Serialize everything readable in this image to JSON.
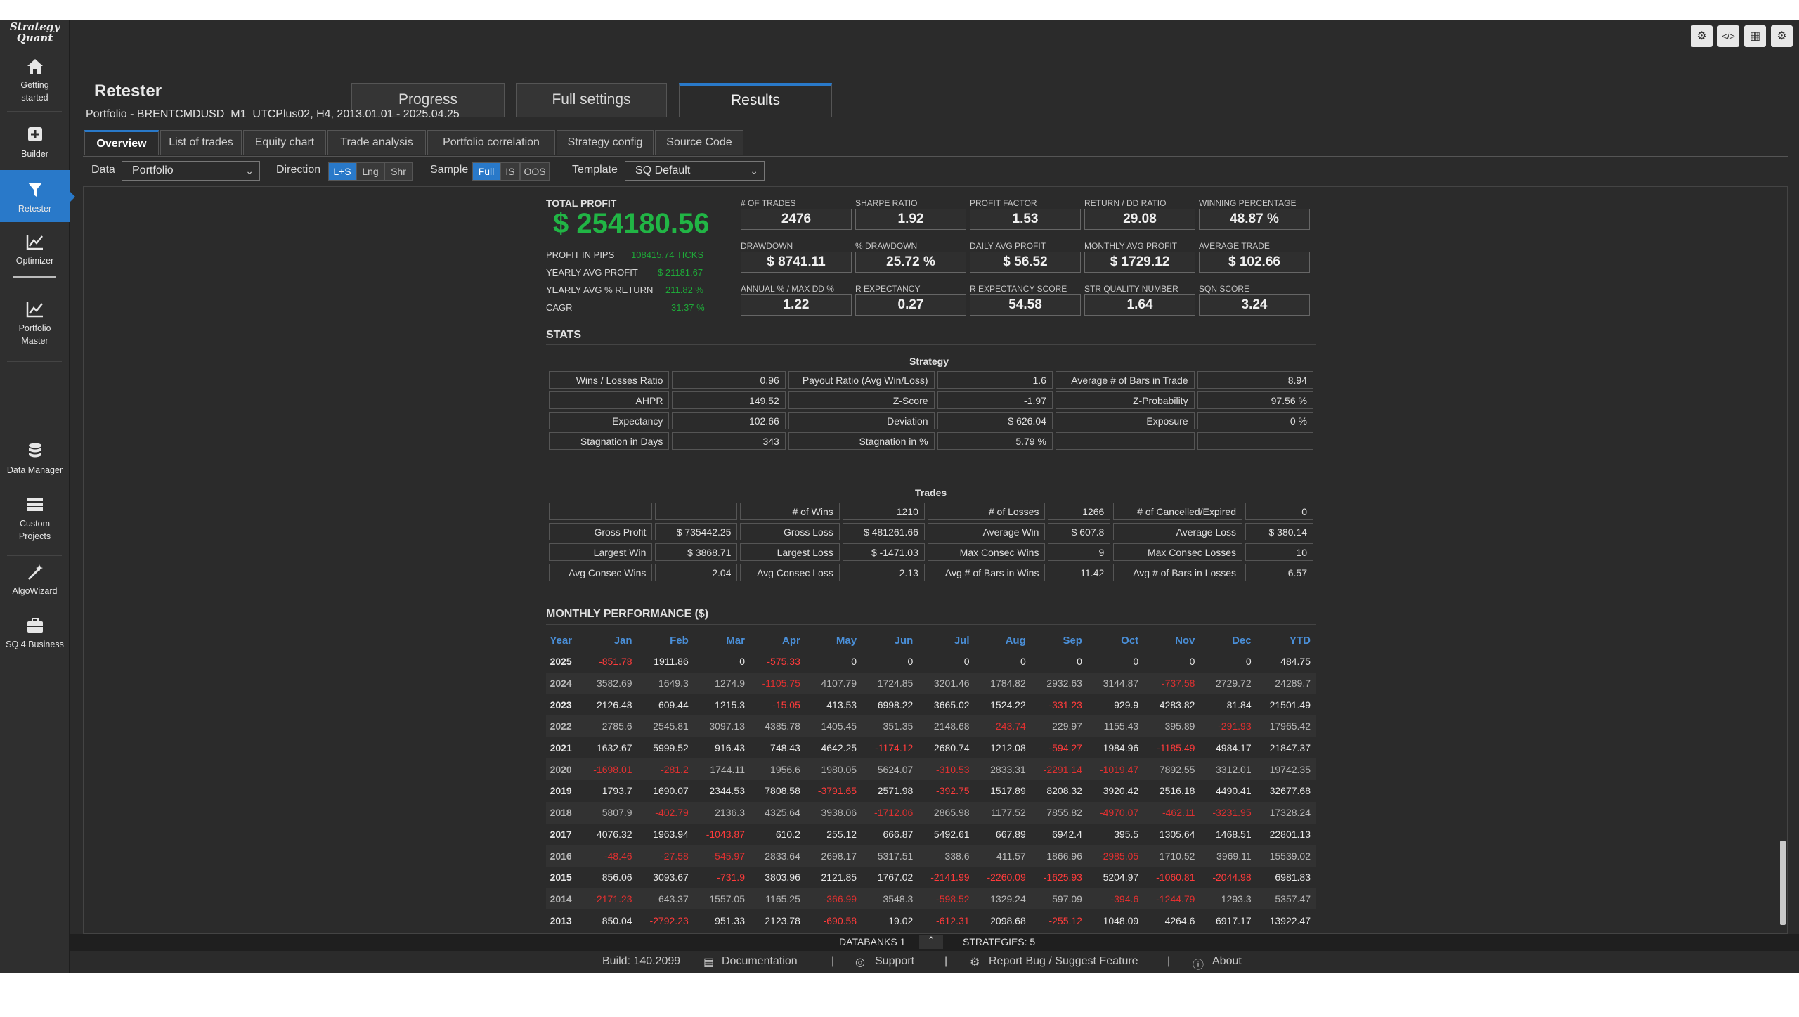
{
  "app": {
    "logo_line1": "Strategy",
    "logo_line2": "Quant"
  },
  "sidebar": {
    "items": [
      {
        "label1": "Getting",
        "label2": "started"
      },
      {
        "label1": "Builder",
        "label2": ""
      },
      {
        "label1": "Retester",
        "label2": ""
      },
      {
        "label1": "Optimizer",
        "label2": ""
      },
      {
        "label1": "Portfolio",
        "label2": "Master"
      },
      {
        "label1": "Data Manager",
        "label2": ""
      },
      {
        "label1": "Custom",
        "label2": "Projects"
      },
      {
        "label1": "AlgoWizard",
        "label2": ""
      },
      {
        "label1": "SQ 4 Business",
        "label2": ""
      }
    ]
  },
  "header": {
    "title": "Retester",
    "tabs": [
      "Progress",
      "Full settings",
      "Results"
    ],
    "active_tab": "Results",
    "portfolio_line": "Portfolio - BRENTCMDUSD_M1_UTCPlus02, H4, 2013.01.01 - 2025.04.25"
  },
  "subtabs": [
    "Overview",
    "List of trades",
    "Equity chart",
    "Trade analysis",
    "Portfolio correlation",
    "Strategy config",
    "Source Code"
  ],
  "filters": {
    "data_label": "Data",
    "data_value": "Portfolio",
    "direction_label": "Direction",
    "direction_options": [
      "L+S",
      "Lng",
      "Shr"
    ],
    "sample_label": "Sample",
    "sample_options": [
      "Full",
      "IS",
      "OOS"
    ],
    "template_label": "Template",
    "template_value": "SQ Default"
  },
  "summary": {
    "total_profit_label": "TOTAL PROFIT",
    "total_profit": "$ 254180.56",
    "rows": [
      {
        "label": "PROFIT IN PIPS",
        "value": "108415.74 TICKS"
      },
      {
        "label": "YEARLY AVG PROFIT",
        "value": "$ 21181.67"
      },
      {
        "label": "YEARLY AVG % RETURN",
        "value": "211.82 %"
      },
      {
        "label": "CAGR",
        "value": "31.37 %"
      }
    ]
  },
  "kpis": [
    {
      "label": "# OF TRADES",
      "value": "2476"
    },
    {
      "label": "SHARPE RATIO",
      "value": "1.92"
    },
    {
      "label": "PROFIT FACTOR",
      "value": "1.53"
    },
    {
      "label": "RETURN / DD RATIO",
      "value": "29.08"
    },
    {
      "label": "WINNING PERCENTAGE",
      "value": "48.87 %"
    },
    {
      "label": "DRAWDOWN",
      "value": "$ 8741.11"
    },
    {
      "label": "% DRAWDOWN",
      "value": "25.72 %"
    },
    {
      "label": "DAILY AVG PROFIT",
      "value": "$ 56.52"
    },
    {
      "label": "MONTHLY AVG PROFIT",
      "value": "$ 1729.12"
    },
    {
      "label": "AVERAGE TRADE",
      "value": "$ 102.66"
    },
    {
      "label": "ANNUAL % / MAX DD %",
      "value": "1.22"
    },
    {
      "label": "R EXPECTANCY",
      "value": "0.27"
    },
    {
      "label": "R EXPECTANCY SCORE",
      "value": "54.58"
    },
    {
      "label": "STR QUALITY NUMBER",
      "value": "1.64"
    },
    {
      "label": "SQN SCORE",
      "value": "3.24"
    }
  ],
  "stats_title": "STATS",
  "strategy_table": {
    "title": "Strategy",
    "rows": [
      [
        "Wins / Losses Ratio",
        "0.96",
        "Payout Ratio (Avg Win/Loss)",
        "1.6",
        "Average # of Bars in Trade",
        "8.94"
      ],
      [
        "AHPR",
        "149.52",
        "Z-Score",
        "-1.97",
        "Z-Probability",
        "97.56 %"
      ],
      [
        "Expectancy",
        "102.66",
        "Deviation",
        "$ 626.04",
        "Exposure",
        "0 %"
      ],
      [
        "Stagnation in Days",
        "343",
        "Stagnation in %",
        "5.79 %",
        "",
        ""
      ]
    ]
  },
  "trades_table": {
    "title": "Trades",
    "rows": [
      [
        "",
        "",
        "# of Wins",
        "1210",
        "# of Losses",
        "1266",
        "# of Cancelled/Expired",
        "0"
      ],
      [
        "Gross Profit",
        "$ 735442.25",
        "Gross Loss",
        "$ 481261.66",
        "Average Win",
        "$ 607.8",
        "Average Loss",
        "$ 380.14"
      ],
      [
        "Largest Win",
        "$ 3868.71",
        "Largest Loss",
        "$ -1471.03",
        "Max Consec Wins",
        "9",
        "Max Consec Losses",
        "10"
      ],
      [
        "Avg Consec Wins",
        "2.04",
        "Avg Consec Loss",
        "2.13",
        "Avg # of Bars in Wins",
        "11.42",
        "Avg # of Bars in Losses",
        "6.57"
      ]
    ]
  },
  "monthly": {
    "title": "MONTHLY PERFORMANCE ($)",
    "headers": [
      "Year",
      "Jan",
      "Feb",
      "Mar",
      "Apr",
      "May",
      "Jun",
      "Jul",
      "Aug",
      "Sep",
      "Oct",
      "Nov",
      "Dec",
      "YTD"
    ],
    "rows": [
      [
        "2025",
        "-851.78",
        "1911.86",
        "0",
        "-575.33",
        "0",
        "0",
        "0",
        "0",
        "0",
        "0",
        "0",
        "0",
        "484.75"
      ],
      [
        "2024",
        "3582.69",
        "1649.3",
        "1274.9",
        "-1105.75",
        "4107.79",
        "1724.85",
        "3201.46",
        "1784.82",
        "2932.63",
        "3144.87",
        "-737.58",
        "2729.72",
        "24289.7"
      ],
      [
        "2023",
        "2126.48",
        "609.44",
        "1215.3",
        "-15.05",
        "413.53",
        "6998.22",
        "3665.02",
        "1524.22",
        "-331.23",
        "929.9",
        "4283.82",
        "81.84",
        "21501.49"
      ],
      [
        "2022",
        "2785.6",
        "2545.81",
        "3097.13",
        "4385.78",
        "1405.45",
        "351.35",
        "2148.68",
        "-243.74",
        "229.97",
        "1155.43",
        "395.89",
        "-291.93",
        "17965.42"
      ],
      [
        "2021",
        "1632.67",
        "5999.52",
        "916.43",
        "748.43",
        "4642.25",
        "-1174.12",
        "2680.74",
        "1212.08",
        "-594.27",
        "1984.96",
        "-1185.49",
        "4984.17",
        "21847.37"
      ],
      [
        "2020",
        "-1698.01",
        "-281.2",
        "1744.11",
        "1956.6",
        "1980.05",
        "5624.07",
        "-310.53",
        "2833.31",
        "-2291.14",
        "-1019.47",
        "7892.55",
        "3312.01",
        "19742.35"
      ],
      [
        "2019",
        "1793.7",
        "1690.07",
        "2344.53",
        "7808.58",
        "-3791.65",
        "2571.98",
        "-392.75",
        "1517.89",
        "8208.32",
        "3920.42",
        "2516.18",
        "4490.41",
        "32677.68"
      ],
      [
        "2018",
        "5807.9",
        "-402.79",
        "2136.3",
        "4325.64",
        "3938.06",
        "-1712.06",
        "2865.98",
        "1177.52",
        "7855.82",
        "-4970.07",
        "-462.11",
        "-3231.95",
        "17328.24"
      ],
      [
        "2017",
        "4076.32",
        "1963.94",
        "-1043.87",
        "610.2",
        "255.12",
        "666.87",
        "5492.61",
        "667.89",
        "6942.4",
        "395.5",
        "1305.64",
        "1468.51",
        "22801.13"
      ],
      [
        "2016",
        "-48.46",
        "-27.58",
        "-545.97",
        "2833.64",
        "2698.17",
        "5317.51",
        "338.6",
        "411.57",
        "1866.96",
        "-2985.05",
        "1710.52",
        "3969.11",
        "15539.02"
      ],
      [
        "2015",
        "856.06",
        "3093.67",
        "-731.9",
        "3803.96",
        "2121.85",
        "1767.02",
        "-2141.99",
        "-2260.09",
        "-1625.93",
        "5204.97",
        "-1060.81",
        "-2044.98",
        "6981.83"
      ],
      [
        "2014",
        "-2171.23",
        "643.37",
        "1557.05",
        "1165.25",
        "-366.99",
        "3548.3",
        "-598.52",
        "1329.24",
        "597.09",
        "-394.6",
        "-1244.79",
        "1293.3",
        "5357.47"
      ],
      [
        "2013",
        "850.04",
        "-2792.23",
        "951.33",
        "2123.78",
        "-690.58",
        "19.02",
        "-612.31",
        "2098.68",
        "-255.12",
        "1048.09",
        "4264.6",
        "6917.17",
        "13922.47"
      ]
    ]
  },
  "footer": {
    "databanks": "DATABANKS 1",
    "strategies": "STRATEGIES: 5",
    "build": "Build: 140.2099",
    "links": [
      "Documentation",
      "Support",
      "Report Bug / Suggest Feature",
      "About"
    ]
  }
}
